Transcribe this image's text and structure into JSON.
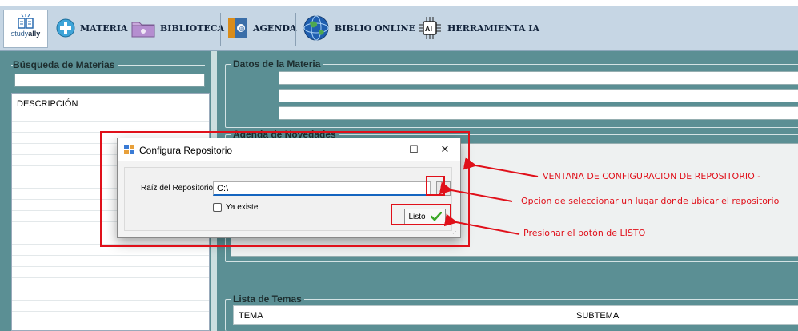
{
  "toolbar": {
    "logo_text_prefix": "study",
    "logo_text_bold": "ally",
    "buttons": [
      {
        "label": "MATERIA",
        "icon": "plus-circle-icon"
      },
      {
        "label": "BIBLIOTECA",
        "icon": "folder-icon"
      },
      {
        "label": "AGENDA",
        "icon": "agenda-notebook-icon"
      },
      {
        "label": "BIBLIO ONLINE",
        "icon": "globe-icon"
      },
      {
        "label": "HERRAMIENTA IA",
        "icon": "ai-chip-icon"
      }
    ]
  },
  "left": {
    "search_group_title": "Búsqueda de Materias",
    "search_value": "",
    "grid_header": "DESCRIPCIÓN"
  },
  "right": {
    "datos_title": "Datos de la Materia",
    "agenda_title": "Agenda de Novedades",
    "temas_title": "Lista de Temas",
    "temas_columns": [
      "TEMA",
      "SUBTEMA"
    ]
  },
  "dialog": {
    "title": "Configura Repositorio",
    "minimize": "—",
    "maximize": "☐",
    "close": "✕",
    "root_label": "Raíz del Repositorio:",
    "root_value": "C:\\",
    "browse_label": "...",
    "exists_label": "Ya existe",
    "exists_checked": false,
    "ok_label": "Listo"
  },
  "annotations": [
    "VENTANA DE CONFIGURACION DE REPOSITORIO -",
    "Opcion de seleccionar un lugar donde ubicar el repositorio",
    "Presionar el botón de LISTO"
  ],
  "colors": {
    "toolbar_bg": "#c6d6e4",
    "panel_teal": "#5b8f94",
    "annotation_red": "#e0101a",
    "input_focus_blue": "#1565c0",
    "check_green": "#3aa626"
  }
}
